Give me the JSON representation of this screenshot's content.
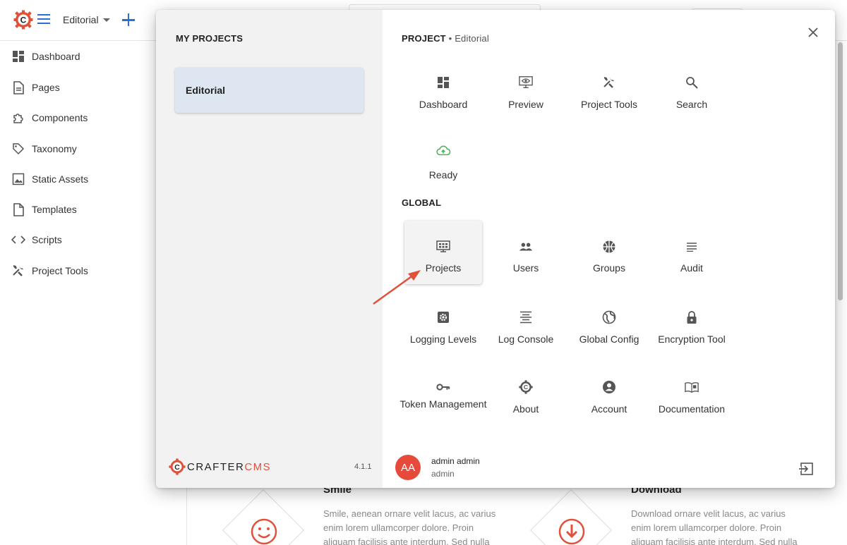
{
  "topbar": {
    "site_name": "Editorial"
  },
  "sidebar": {
    "items": [
      {
        "label": "Dashboard",
        "icon": "dashboard-icon"
      },
      {
        "label": "Pages",
        "icon": "page-icon"
      },
      {
        "label": "Components",
        "icon": "puzzle-icon"
      },
      {
        "label": "Taxonomy",
        "icon": "tag-icon"
      },
      {
        "label": "Static Assets",
        "icon": "image-icon"
      },
      {
        "label": "Templates",
        "icon": "file-icon"
      },
      {
        "label": "Scripts",
        "icon": "code-icon"
      },
      {
        "label": "Project Tools",
        "icon": "tools-icon"
      }
    ]
  },
  "background": {
    "col1_heading": "Smile",
    "col1_text": "Smile, aenean ornare velit lacus, ac varius enim lorem ullamcorper dolore. Proin aliquam facilisis ante interdum. Sed nulla",
    "col2_heading": "Download",
    "col2_text": "Download ornare velit lacus, ac varius enim lorem ullamcorper dolore. Proin aliquam facilisis ante interdum. Sed nulla amet lorem"
  },
  "dialog": {
    "my_projects_title": "MY PROJECTS",
    "projects": [
      "Editorial"
    ],
    "brand": {
      "prefix": "CRAFTER",
      "suffix": "CMS"
    },
    "version": "4.1.1",
    "project_section": {
      "title": "PROJECT",
      "subtitle": "• Editorial"
    },
    "project_tools": [
      {
        "label": "Dashboard",
        "icon": "dashboard-icon"
      },
      {
        "label": "Preview",
        "icon": "preview-icon"
      },
      {
        "label": "Project Tools",
        "icon": "tools-icon"
      },
      {
        "label": "Search",
        "icon": "search-icon"
      },
      {
        "label": "Ready",
        "icon": "cloud-upload-icon"
      }
    ],
    "global_section": {
      "title": "GLOBAL"
    },
    "global_tools": [
      {
        "label": "Projects",
        "icon": "projects-icon"
      },
      {
        "label": "Users",
        "icon": "users-icon"
      },
      {
        "label": "Groups",
        "icon": "groups-icon"
      },
      {
        "label": "Audit",
        "icon": "audit-icon"
      },
      {
        "label": "Logging Levels",
        "icon": "gear-icon"
      },
      {
        "label": "Log Console",
        "icon": "log-console-icon"
      },
      {
        "label": "Global Config",
        "icon": "globe-icon"
      },
      {
        "label": "Encryption Tool",
        "icon": "lock-icon"
      },
      {
        "label": "Token Management",
        "icon": "key-icon"
      },
      {
        "label": "About",
        "icon": "crafter-icon"
      },
      {
        "label": "Account",
        "icon": "account-icon"
      },
      {
        "label": "Documentation",
        "icon": "book-icon"
      }
    ],
    "user": {
      "initials": "AA",
      "name": "admin admin",
      "login": "admin"
    }
  },
  "colors": {
    "accent": "#2b6fd6",
    "brand_red": "#e0513b",
    "ready_green": "#3bb54a",
    "selected_project_bg": "#dde6f1"
  }
}
